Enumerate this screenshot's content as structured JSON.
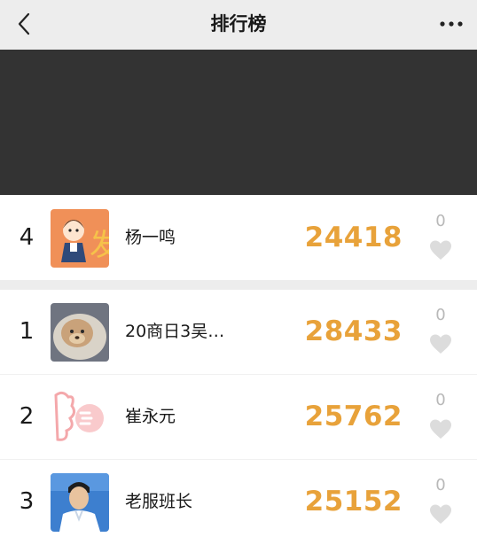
{
  "header": {
    "title": "排行榜",
    "back_icon": "chevron-left-icon",
    "more_icon": "more-horizontal-icon"
  },
  "my_rank": {
    "rank": "4",
    "name": "杨一鸣",
    "steps": "24418",
    "likes": "0"
  },
  "ranking": [
    {
      "rank": "1",
      "name": "20商日3吴…",
      "steps": "28433",
      "likes": "0"
    },
    {
      "rank": "2",
      "name": "崔永元",
      "steps": "25762",
      "likes": "0"
    },
    {
      "rank": "3",
      "name": "老服班长",
      "steps": "25152",
      "likes": "0"
    }
  ],
  "colors": {
    "steps": "#e8a23a",
    "like_icon": "#dcdcdc",
    "header_bg": "#ededed",
    "banner_bg": "#333333"
  }
}
